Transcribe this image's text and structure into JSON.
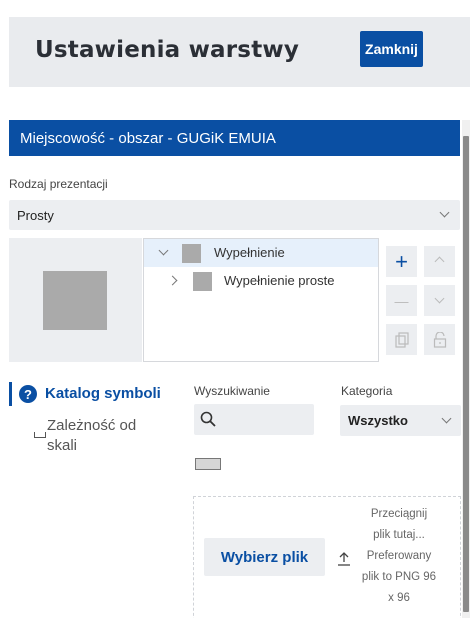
{
  "dialog": {
    "title": "Ustawienia warstwy",
    "close_label": "Zamknij"
  },
  "layer": {
    "name": "Miejscowość - obszar - GUGiK EMUIA"
  },
  "presentation": {
    "label": "Rodzaj prezentacji",
    "value": "Prosty"
  },
  "symbol_tree": {
    "items": [
      {
        "label": "Wypełnienie",
        "expanded": true
      },
      {
        "label": "Wypełnienie proste",
        "expanded": false
      }
    ]
  },
  "tools": {
    "add": "+",
    "up": "⌃",
    "remove": "—",
    "down": "⌄"
  },
  "tabs": {
    "catalog": "Katalog symboli",
    "help_glyph": "?",
    "scale_line1": "Zależność od",
    "scale_line2": "skali"
  },
  "search": {
    "label": "Wyszukiwanie"
  },
  "category": {
    "label": "Kategoria",
    "value": "Wszystko"
  },
  "upload": {
    "button": "Wybierz plik",
    "hint_lines": [
      "Przeciągnij",
      "plik tutaj...",
      "Preferowany",
      "plik to PNG 96",
      "x 96"
    ]
  },
  "colors": {
    "accent": "#0a4fa3",
    "panel": "#eceef1",
    "swatch": "#aaaaaa"
  }
}
